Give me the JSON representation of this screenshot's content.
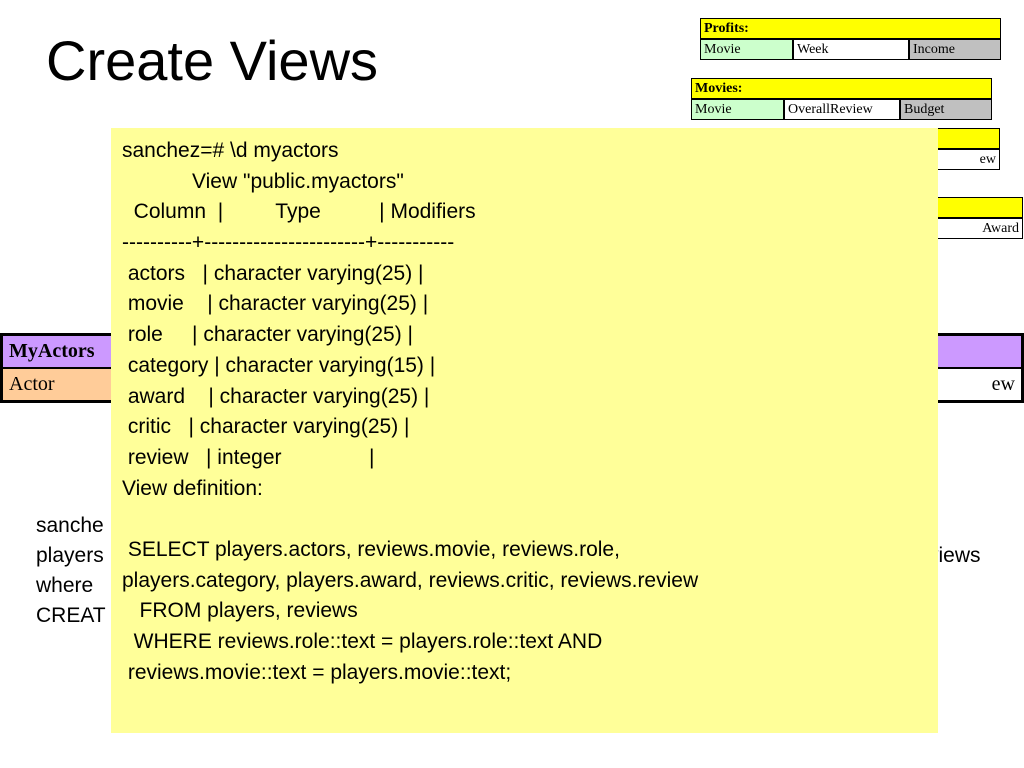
{
  "title": "Create Views",
  "profits": {
    "header": "Profits:",
    "cols": [
      "Movie",
      "Week",
      "Income"
    ],
    "colors": [
      "#ccffcc",
      "#ffffff",
      "#c0c0c0"
    ]
  },
  "movies": {
    "header": "Movies:",
    "cols": [
      "Movie",
      "OverallReview",
      "Budget"
    ],
    "colors": [
      "#ccffcc",
      "#ffffff",
      "#c0c0c0"
    ]
  },
  "reviews_partial": {
    "cell": "ew"
  },
  "players_partial": {
    "cell": "Award"
  },
  "myactors": {
    "header": "MyActors",
    "first_col": "Actor",
    "last_col": "ew"
  },
  "background_lines": [
    "sanche",
    "players",
    "where",
    "CREAT"
  ],
  "background_right": "views",
  "terminal_lines": [
    "sanchez=# \\d myactors",
    "            View \"public.myactors\"",
    "  Column  |         Type          | Modifiers",
    "----------+-----------------------+-----------",
    " actors   | character varying(25) |",
    " movie    | character varying(25) |",
    " role     | character varying(25) |",
    " category | character varying(15) |",
    " award    | character varying(25) |",
    " critic   | character varying(25) |",
    " review   | integer               |",
    "View definition:",
    "",
    " SELECT players.actors, reviews.movie, reviews.role,",
    "players.category, players.award, reviews.critic, reviews.review",
    "   FROM players, reviews",
    "  WHERE reviews.role::text = players.role::text AND",
    " reviews.movie::text = players.movie::text;"
  ]
}
